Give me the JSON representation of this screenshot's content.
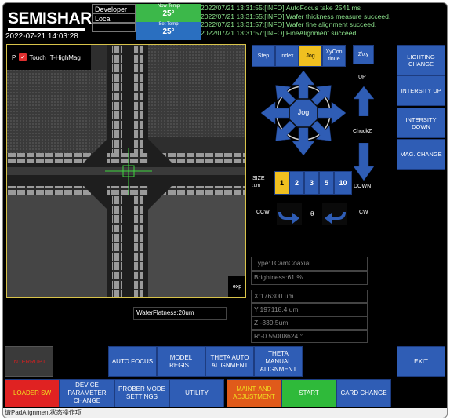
{
  "header": {
    "logo": "SEMISHARE",
    "datetime": "2022-07-21 14:03:28",
    "user": "Developer",
    "mode": "Local",
    "now_temp_label": "Now Temp",
    "now_temp_value": "25°",
    "set_temp_label": "Set Temp",
    "set_temp_value": "25°",
    "log": [
      "2022/07/21 13:31:55:[INFO]:AutoFocus take 2541 ms",
      "2022/07/21 13:31:55:[INFO]:Wafer thickness measure succeed.",
      "2022/07/21 13:31:57:[INFO]:Wafer fine alignment succeed.",
      "2022/07/21 13:31:57:[INFO]:FineAlignment succeed."
    ]
  },
  "camera": {
    "p_label": "P",
    "touch_label": "Touch",
    "touch_checked": true,
    "mag_label": "T-HighMag",
    "exp_label": "exp",
    "flatness": "WaferFlatness:20um"
  },
  "jog": {
    "tabs": [
      "Step",
      "Index",
      "Jog",
      "XyCon tinue"
    ],
    "active_tab": "Jog",
    "zxy_label": "Z\\xy",
    "center_label": "Jog",
    "up_label": "UP",
    "chuck_label": "ChuckZ",
    "down_label": "DOWN",
    "size_label": "SIZE",
    "size_unit": ":um",
    "sizes": [
      "1",
      "2",
      "3",
      "5",
      "10"
    ],
    "selected_size": "1",
    "ccw_label": "CCW",
    "theta_label": "θ",
    "cw_label": "CW"
  },
  "right_buttons": [
    "LIGHTING CHANGE",
    "INTERSITY UP",
    "INTERSITY DOWN",
    "MAG. CHANGE"
  ],
  "info": {
    "type": "Type:TCamCoaxial",
    "brightness": "Brightness:61 %",
    "x": "X:176300 um",
    "y": "Y:197118.4 um",
    "z": "Z:-339.5um",
    "r": "R:-0.55008624 °"
  },
  "action_row": {
    "interrupt": "INTERRUPT",
    "buttons": [
      "AUTO FOCUS",
      "MODEL REGIST",
      "THETA AUTO ALIGNMENT",
      "THETA MANUAL ALIGNMENT"
    ],
    "exit": "EXIT"
  },
  "bottom_row": [
    {
      "label": "LOADER SW",
      "color": "#e02222",
      "text_color": "#f0e020"
    },
    {
      "label": "DEVICE PARAMETER CHANGE",
      "color": "#2f5db5",
      "text_color": "#ffffff"
    },
    {
      "label": "PROBER MODE SETTINGS",
      "color": "#2f5db5",
      "text_color": "#ffffff"
    },
    {
      "label": "UTILITY",
      "color": "#2f5db5",
      "text_color": "#ffffff"
    },
    {
      "label": "MAINT. AND ADJUSTMENT",
      "color": "#e05a1a",
      "text_color": "#f0e020"
    },
    {
      "label": "START",
      "color": "#2fba3a",
      "text_color": "#ffffff"
    },
    {
      "label": "CARD CHANGE",
      "color": "#2f5db5",
      "text_color": "#ffffff"
    }
  ],
  "status": "请PadAlignment状态操作项",
  "colors": {
    "button_blue": "#2f5db5",
    "accent_yellow": "#f0c020",
    "log_green": "#8ce38c",
    "temp_green": "#3cb84a"
  }
}
